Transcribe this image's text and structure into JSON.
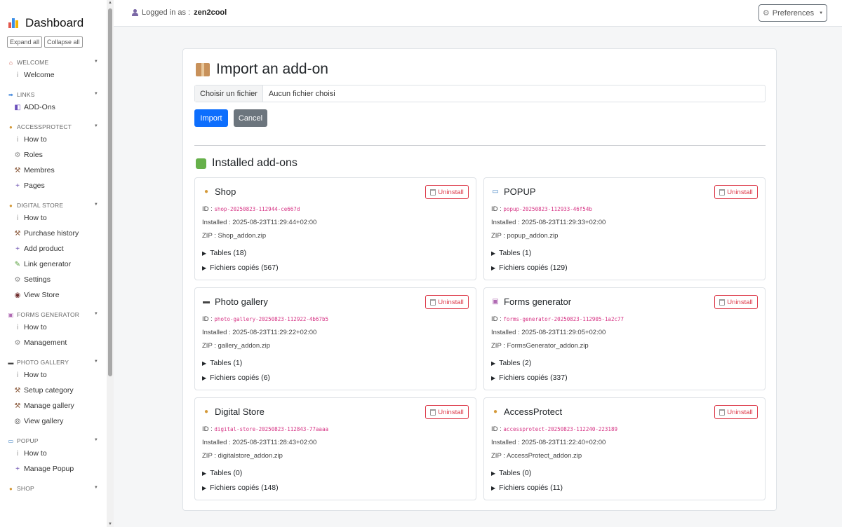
{
  "sidebar": {
    "title": "Dashboard",
    "expand_label": "Expand all",
    "collapse_label": "Collapse all",
    "sections": [
      {
        "label": "WELCOME",
        "icon": "house-icon",
        "items": [
          {
            "label": "Welcome",
            "icon": "info-icon"
          }
        ]
      },
      {
        "label": "LINKS",
        "icon": "arrow-right-icon",
        "items": [
          {
            "label": "ADD-Ons",
            "icon": "addon-icon"
          }
        ]
      },
      {
        "label": "ACCESSPROTECT",
        "icon": "money-bag-icon",
        "items": [
          {
            "label": "How to",
            "icon": "info-icon"
          },
          {
            "label": "Roles",
            "icon": "gear-icon"
          },
          {
            "label": "Membres",
            "icon": "hammer-icon"
          },
          {
            "label": "Pages",
            "icon": "plus-icon"
          }
        ]
      },
      {
        "label": "DIGITAL STORE",
        "icon": "money-bag-icon",
        "items": [
          {
            "label": "How to",
            "icon": "info-icon"
          },
          {
            "label": "Purchase history",
            "icon": "hammer-icon"
          },
          {
            "label": "Add product",
            "icon": "plus-icon"
          },
          {
            "label": "Link generator",
            "icon": "pen-icon"
          },
          {
            "label": "Settings",
            "icon": "gear-icon"
          },
          {
            "label": "View Store",
            "icon": "eye-icon"
          }
        ]
      },
      {
        "label": "FORMS GENERATOR",
        "icon": "inbox-icon",
        "items": [
          {
            "label": "How to",
            "icon": "info-icon"
          },
          {
            "label": "Management",
            "icon": "gear-icon"
          }
        ]
      },
      {
        "label": "PHOTO GALLERY",
        "icon": "camera-icon",
        "items": [
          {
            "label": "How to",
            "icon": "info-icon"
          },
          {
            "label": "Setup category",
            "icon": "hammer-icon"
          },
          {
            "label": "Manage gallery",
            "icon": "hammer-icon"
          },
          {
            "label": "View gallery",
            "icon": "eyes-icon"
          }
        ]
      },
      {
        "label": "POPUP",
        "icon": "id-card-icon",
        "items": [
          {
            "label": "How to",
            "icon": "info-icon"
          },
          {
            "label": "Manage Popup",
            "icon": "plus-icon"
          }
        ]
      },
      {
        "label": "SHOP",
        "icon": "money-bag-icon",
        "items": []
      }
    ]
  },
  "topbar": {
    "logged_prefix": "Logged in as :",
    "username": "zen2cool",
    "preferences_label": "Preferences"
  },
  "import": {
    "title": "Import an add-on",
    "file_button": "Choisir un fichier",
    "file_name": "Aucun fichier choisi",
    "import_label": "Import",
    "cancel_label": "Cancel"
  },
  "installed": {
    "title": "Installed add-ons",
    "uninstall_label": "Uninstall",
    "addons": [
      {
        "name": "Shop",
        "icon": "money-bag-icon",
        "id_label": "ID :",
        "id": "shop-20250823-112944-ce667d",
        "installed": "Installed : 2025-08-23T11:29:44+02:00",
        "zip": "ZIP : Shop_addon.zip",
        "tables": "Tables (18)",
        "files": "Fichiers copiés (567)"
      },
      {
        "name": "POPUP",
        "icon": "id-card-icon",
        "id_label": "ID :",
        "id": "popup-20250823-112933-46f54b",
        "installed": "Installed : 2025-08-23T11:29:33+02:00",
        "zip": "ZIP : popup_addon.zip",
        "tables": "Tables (1)",
        "files": "Fichiers copiés (129)"
      },
      {
        "name": "Photo gallery",
        "icon": "camera-icon",
        "id_label": "ID :",
        "id": "photo-gallery-20250823-112922-4b67b5",
        "installed": "Installed : 2025-08-23T11:29:22+02:00",
        "zip": "ZIP : gallery_addon.zip",
        "tables": "Tables (1)",
        "files": "Fichiers copiés (6)"
      },
      {
        "name": "Forms generator",
        "icon": "inbox-icon",
        "id_label": "ID :",
        "id": "forms-generator-20250823-112905-1a2c77",
        "installed": "Installed : 2025-08-23T11:29:05+02:00",
        "zip": "ZIP : FormsGenerator_addon.zip",
        "tables": "Tables (2)",
        "files": "Fichiers copiés (337)"
      },
      {
        "name": "Digital Store",
        "icon": "money-bag-icon",
        "id_label": "ID :",
        "id": "digital-store-20250823-112843-77aaaa",
        "installed": "Installed : 2025-08-23T11:28:43+02:00",
        "zip": "ZIP : digitalstore_addon.zip",
        "tables": "Tables (0)",
        "files": "Fichiers copiés (148)"
      },
      {
        "name": "AccessProtect",
        "icon": "money-bag-icon",
        "id_label": "ID :",
        "id": "accessprotect-20250823-112240-223189",
        "installed": "Installed : 2025-08-23T11:22:40+02:00",
        "zip": "ZIP : AccessProtect_addon.zip",
        "tables": "Tables (0)",
        "files": "Fichiers copiés (11)"
      }
    ]
  }
}
